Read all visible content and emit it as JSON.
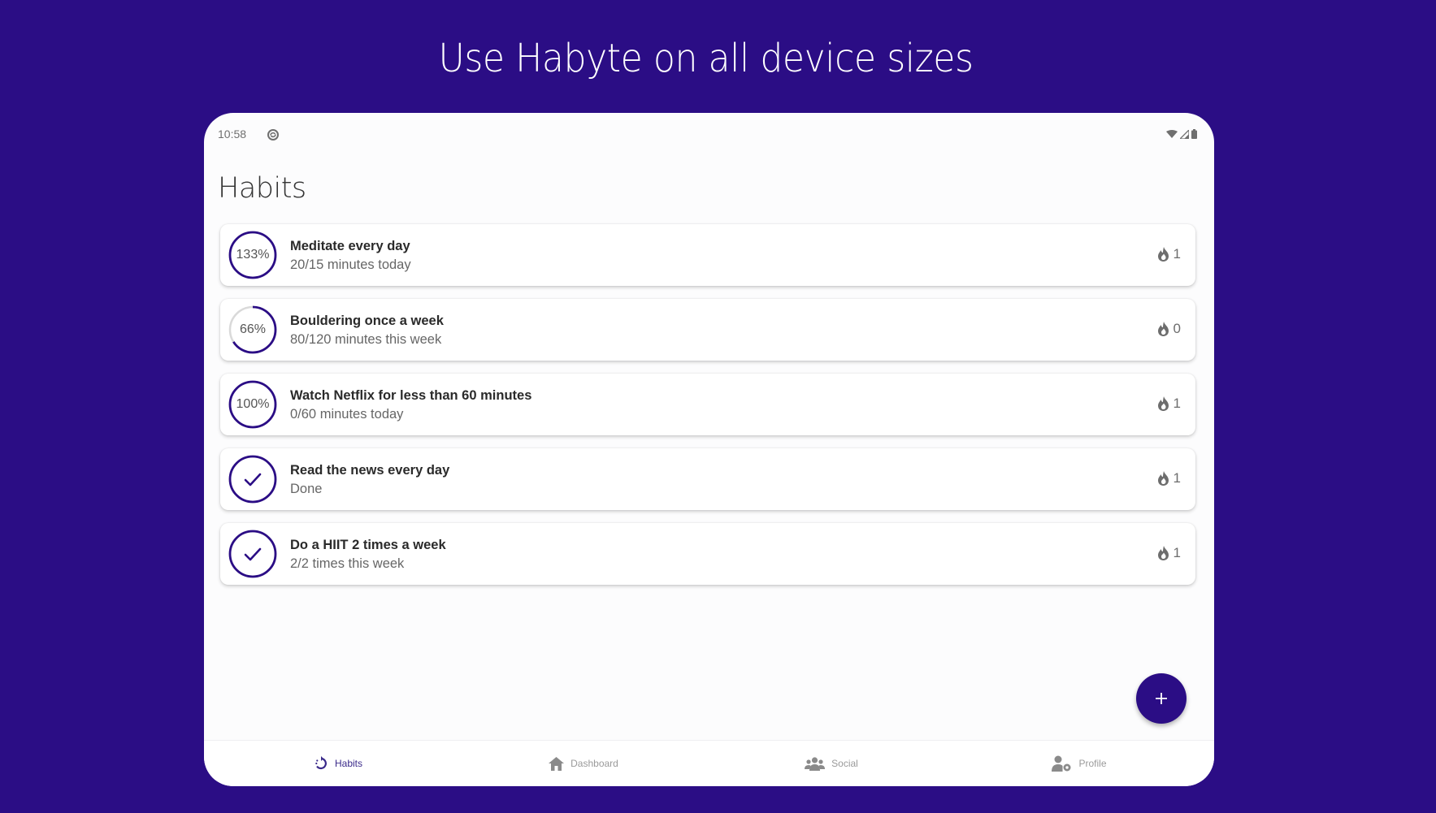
{
  "headline": "Use Habyte on all device sizes",
  "colors": {
    "background": "#2b0d85",
    "accent": "#2b0d85",
    "ring_track": "#d9d9d9",
    "icon_grey": "#6d6d6d"
  },
  "status_bar": {
    "time": "10:58",
    "left_icons": [
      "sync-icon"
    ],
    "right_icons": [
      "wifi-icon",
      "signal-icon",
      "battery-icon"
    ]
  },
  "page": {
    "title": "Habits"
  },
  "habits": [
    {
      "title": "Meditate every day",
      "subtitle": "20/15 minutes today",
      "progress_label": "133%",
      "progress": 1.33,
      "done": false,
      "streak_icon": "flame-icon",
      "streak": "1"
    },
    {
      "title": "Bouldering once a week",
      "subtitle": "80/120 minutes this week",
      "progress_label": "66%",
      "progress": 0.66,
      "done": false,
      "streak_icon": "flame-icon",
      "streak": "0"
    },
    {
      "title": "Watch Netflix for less than 60 minutes",
      "subtitle": "0/60 minutes today",
      "progress_label": "100%",
      "progress": 1.0,
      "done": false,
      "streak_icon": "flame-icon",
      "streak": "1"
    },
    {
      "title": "Read the news every day",
      "subtitle": "Done",
      "progress_label": "",
      "progress": 1.0,
      "done": true,
      "streak_icon": "flame-icon",
      "streak": "1"
    },
    {
      "title": "Do a HIIT 2 times a week",
      "subtitle": "2/2 times this week",
      "progress_label": "",
      "progress": 1.0,
      "done": true,
      "streak_icon": "flame-icon",
      "streak": "1"
    }
  ],
  "fab": {
    "icon": "plus-icon",
    "label": "+"
  },
  "bottom_nav": [
    {
      "label": "Habits",
      "icon": "habits-cycle-icon",
      "active": true
    },
    {
      "label": "Dashboard",
      "icon": "home-icon",
      "active": false
    },
    {
      "label": "Social",
      "icon": "group-icon",
      "active": false
    },
    {
      "label": "Profile",
      "icon": "profile-settings-icon",
      "active": false
    }
  ]
}
